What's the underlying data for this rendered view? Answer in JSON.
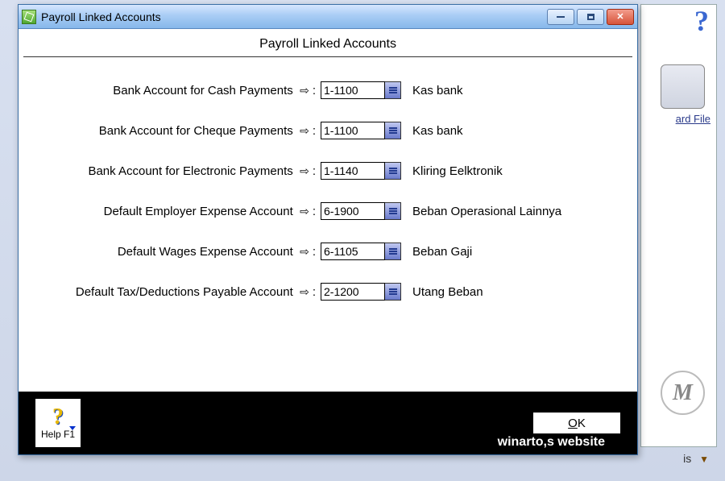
{
  "background": {
    "card_file_label": "ard File",
    "bottom_menu": "is",
    "m_badge": "M"
  },
  "window": {
    "title": "Payroll Linked Accounts",
    "panel_title": "Payroll Linked Accounts"
  },
  "rows": [
    {
      "label": "Bank Account for Cash Payments",
      "value": "1-1100",
      "desc": "Kas bank"
    },
    {
      "label": "Bank Account for Cheque Payments",
      "value": "1-1100",
      "desc": "Kas bank"
    },
    {
      "label": "Bank Account for Electronic Payments",
      "value": "1-1140",
      "desc": "Kliring Eelktronik"
    },
    {
      "label": "Default Employer Expense Account",
      "value": "6-1900",
      "desc": "Beban Operasional Lainnya"
    },
    {
      "label": "Default Wages Expense Account",
      "value": "6-1105",
      "desc": "Beban Gaji"
    },
    {
      "label": "Default Tax/Deductions Payable Account",
      "value": "2-1200",
      "desc": "Utang Beban"
    }
  ],
  "footer": {
    "help_label": "Help F1",
    "ok_label": "OK"
  },
  "watermark": "winarto,s website"
}
